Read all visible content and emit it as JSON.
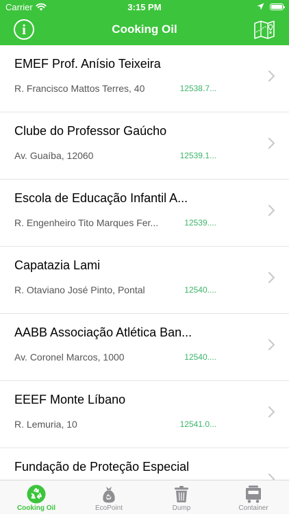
{
  "status_bar": {
    "carrier": "Carrier",
    "time": "3:15 PM"
  },
  "nav": {
    "title": "Cooking Oil",
    "info_icon": "info-icon",
    "map_icon": "map-icon"
  },
  "locations": [
    {
      "name": "EMEF Prof. Anísio Teixeira",
      "address": "R. Francisco Mattos Terres, 40",
      "code": "12538.7..."
    },
    {
      "name": "Clube do Professor Gaúcho",
      "address": "Av. Guaíba, 12060",
      "code": "12539.1..."
    },
    {
      "name": "Escola de Educação Infantil A...",
      "address": "R. Engenheiro Tito Marques Fer...",
      "code": "12539...."
    },
    {
      "name": "Capatazia Lami",
      "address": "R. Otaviano José Pinto, Pontal",
      "code": "12540...."
    },
    {
      "name": "AABB Associação Atlética Ban...",
      "address": "Av. Coronel Marcos, 1000",
      "code": "12540...."
    },
    {
      "name": "EEEF Monte Líbano",
      "address": "R. Lemuria, 10",
      "code": "12541.0..."
    },
    {
      "name": "Fundação de Proteção Especial",
      "address": "",
      "code": ""
    }
  ],
  "tabs": [
    {
      "label": "Cooking Oil",
      "icon": "recycle-icon",
      "active": true
    },
    {
      "label": "EcoPoint",
      "icon": "bag-icon",
      "active": false
    },
    {
      "label": "Dump",
      "icon": "trash-icon",
      "active": false
    },
    {
      "label": "Container",
      "icon": "container-icon",
      "active": false
    }
  ],
  "colors": {
    "accent": "#3cc43c",
    "code_text": "#3cb46a",
    "tab_inactive": "#8e8e93"
  }
}
